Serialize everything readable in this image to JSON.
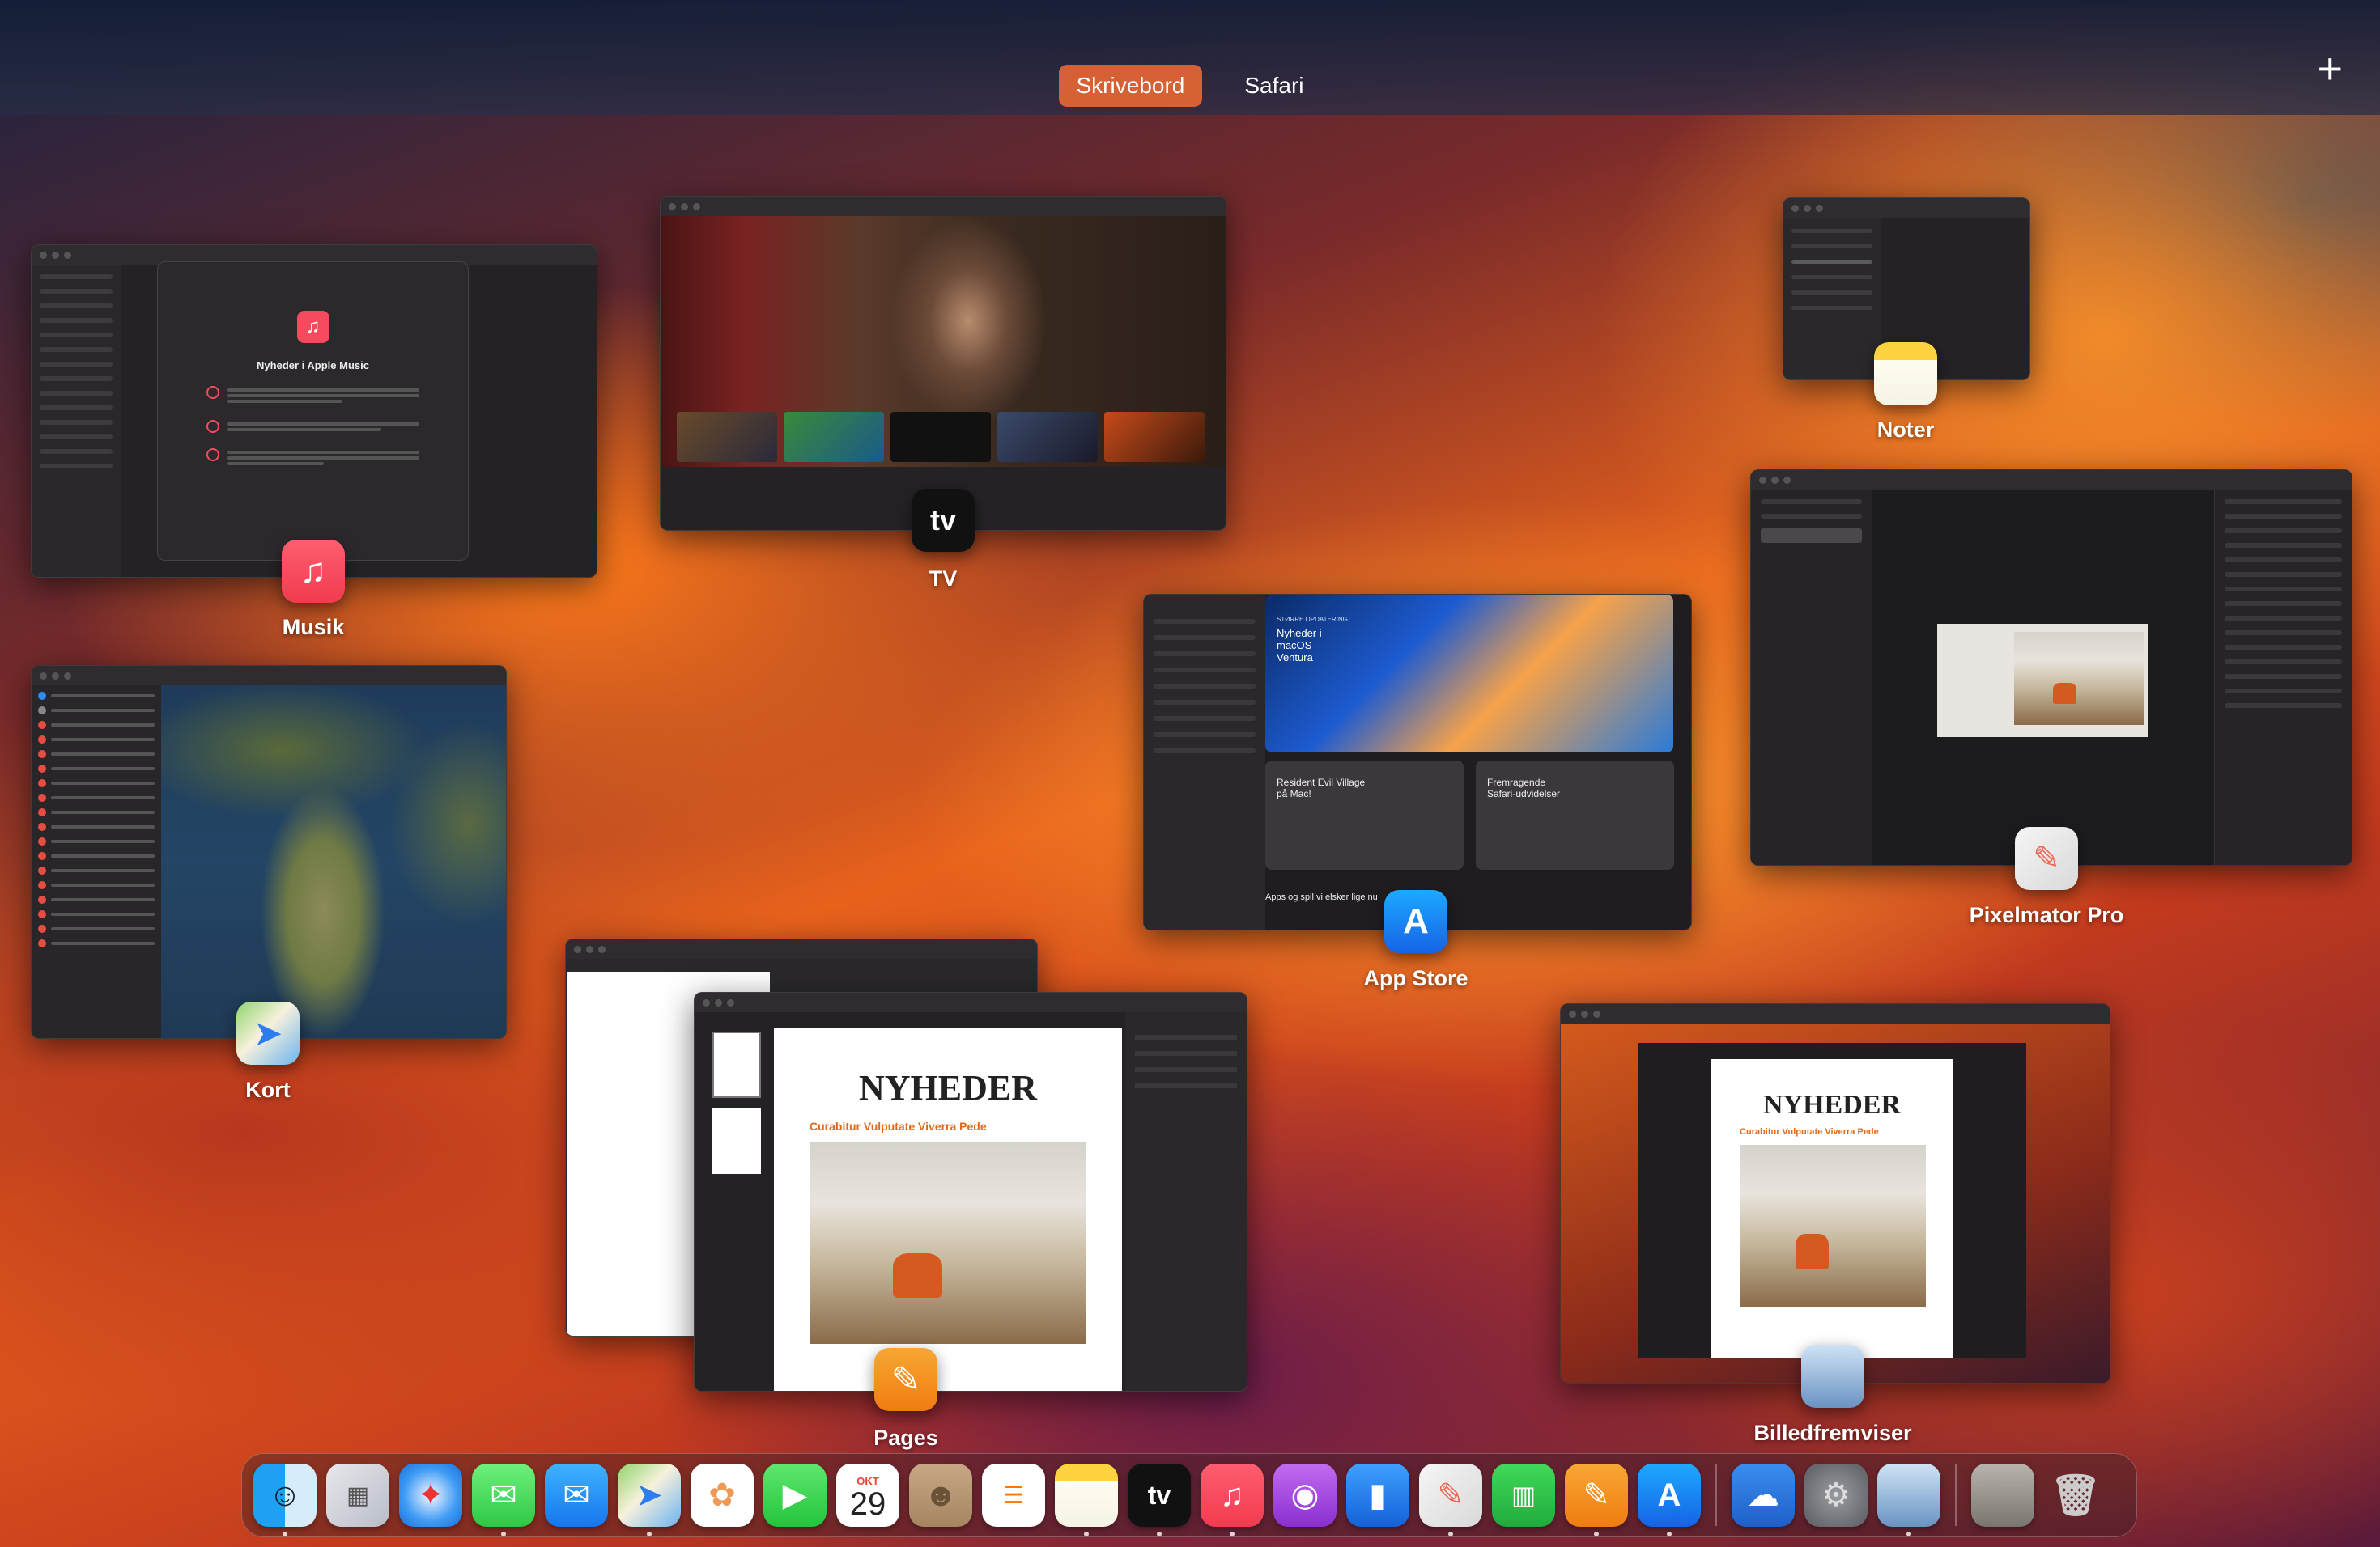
{
  "spaces": {
    "tabs": [
      {
        "label": "Skrivebord",
        "active": true
      },
      {
        "label": "Safari",
        "active": false
      }
    ],
    "add_label": "+"
  },
  "windows": {
    "music": {
      "app": "Musik",
      "dialog_title": "Nyheder i Apple Music"
    },
    "tv": {
      "app": "TV",
      "icon_text": "tv"
    },
    "notes": {
      "app": "Noter"
    },
    "pixelmator": {
      "app": "Pixelmator Pro"
    },
    "appstore": {
      "app": "App Store",
      "feature_text": "Nyheder i macOS Ventura",
      "feature_kicker": "STØRRE OPDATERING",
      "card1_title": "Resident Evil Village på Mac!",
      "card2_title": "Fremragende Safari-udvidelser",
      "bottom_heading": "Apps og spil vi elsker lige nu"
    },
    "maps": {
      "app": "Kort"
    },
    "pages": {
      "app": "Pages",
      "headline": "NYHEDER",
      "subheadline": "Curabitur Vulputate Viverra Pede"
    },
    "preview": {
      "app": "Billedfremviser",
      "headline": "NYHEDER",
      "subheadline": "Curabitur Vulputate Viverra Pede"
    }
  },
  "dock": {
    "calendar_month": "OKT",
    "calendar_day": "29",
    "tv_text": "tv"
  },
  "colors": {
    "active_space": "#e86734",
    "music_red": "#f64b5f",
    "pages_orange": "#f28a1e"
  }
}
